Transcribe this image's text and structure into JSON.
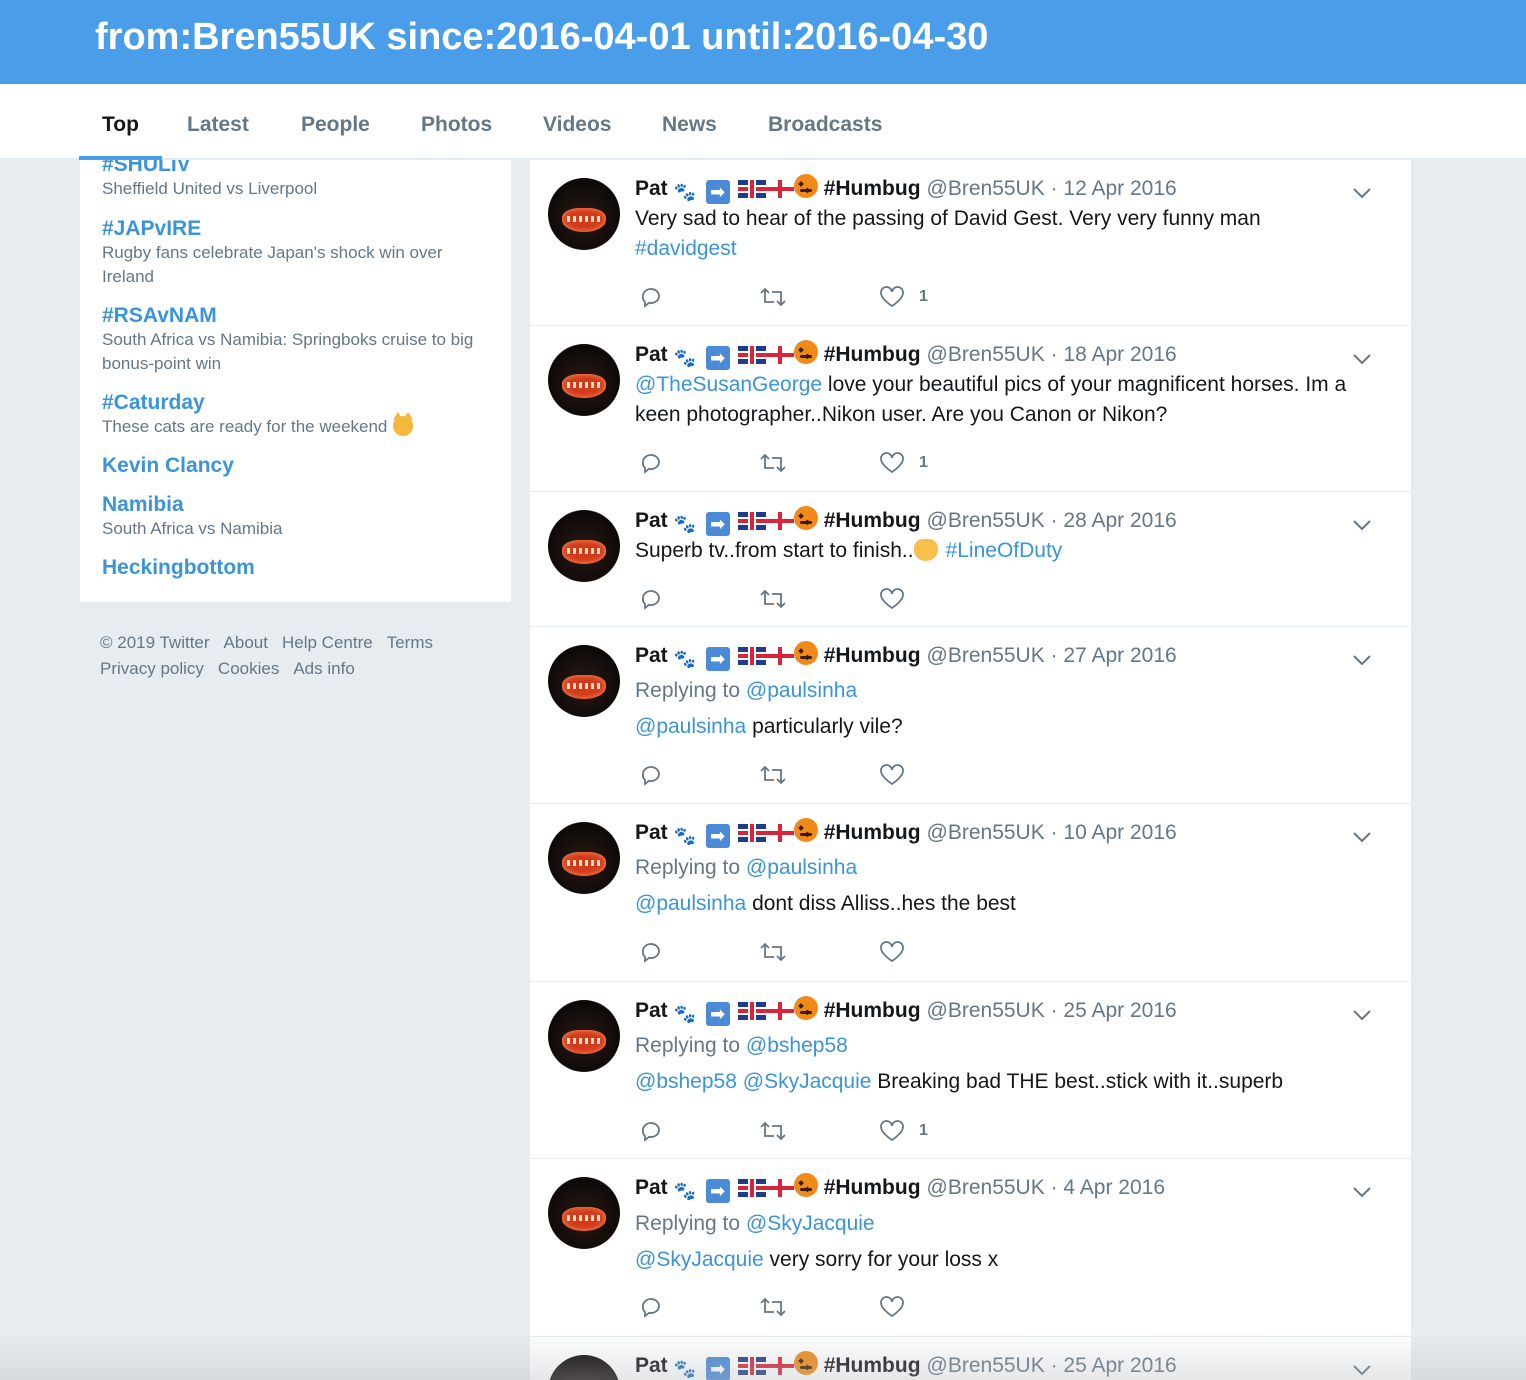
{
  "search": {
    "query": "from:Bren55UK since:2016-04-01 until:2016-04-30"
  },
  "nav": {
    "tabs": [
      {
        "label": "Top",
        "active": true
      },
      {
        "label": "Latest"
      },
      {
        "label": "People"
      },
      {
        "label": "Photos"
      },
      {
        "label": "Videos"
      },
      {
        "label": "News"
      },
      {
        "label": "Broadcasts"
      }
    ]
  },
  "trends": [
    {
      "name": "#SHULIV",
      "desc": "Sheffield United vs Liverpool"
    },
    {
      "name": "#JAPvIRE",
      "desc": "Rugby fans celebrate Japan's shock win over Ireland"
    },
    {
      "name": "#RSAvNAM",
      "desc": "South Africa vs Namibia: Springboks cruise to big bonus-point win"
    },
    {
      "name": "#Caturday",
      "desc": "These cats are ready for the weekend"
    },
    {
      "name": "Kevin Clancy",
      "desc": ""
    },
    {
      "name": "Namibia",
      "desc": "South Africa vs Namibia"
    },
    {
      "name": "Heckingbottom",
      "desc": ""
    }
  ],
  "footer": {
    "links": [
      "© 2019 Twitter",
      "About",
      "Help Centre",
      "Terms",
      "Privacy policy",
      "Cookies",
      "Ads info"
    ]
  },
  "user": {
    "name": "Pat",
    "name_suffix": "#Humbug",
    "handle": "@Bren55UK",
    "separator": "·",
    "arrow_glyph": "➡"
  },
  "tweets": [
    {
      "date": "12 Apr 2016",
      "text": "Very sad to hear of the passing of David Gest. Very very funny man",
      "hashtag": "#davidgest",
      "likes": "1"
    },
    {
      "date": "18 Apr 2016",
      "mention": "@TheSusanGeorge",
      "text": " love your beautiful pics of your magnificent horses. Im a keen photographer..Nikon user. Are you Canon or Nikon?",
      "likes": "1"
    },
    {
      "date": "28 Apr 2016",
      "text": "Superb tv..from start to finish..",
      "hashtag": "#LineOfDuty",
      "likes": ""
    },
    {
      "date": "27 Apr 2016",
      "reply_label": "Replying to ",
      "reply_to": "@paulsinha",
      "mention": "@paulsinha",
      "text": " particularly vile?",
      "likes": ""
    },
    {
      "date": "10 Apr 2016",
      "reply_label": "Replying to ",
      "reply_to": "@paulsinha",
      "mention": "@paulsinha",
      "text": " dont diss Alliss..hes the best",
      "likes": ""
    },
    {
      "date": "25 Apr 2016",
      "reply_label": "Replying to ",
      "reply_to": "@bshep58",
      "mention": "@bshep58",
      "mention2": "@SkyJacquie",
      "text": " Breaking bad THE best..stick with it..superb",
      "likes": "1"
    },
    {
      "date": "4 Apr 2016",
      "reply_label": "Replying to ",
      "reply_to": "@SkyJacquie",
      "mention": "@SkyJacquie",
      "text": " very sorry for your loss x",
      "likes": ""
    },
    {
      "date": "25 Apr 2016"
    }
  ],
  "colors": {
    "header_bg": "#4a9de8",
    "link": "#3b94d9",
    "muted": "#657786",
    "page_bg": "#e6ecf0"
  },
  "icons": {
    "reply": "reply-icon",
    "retweet": "retweet-icon",
    "like": "heart-icon",
    "more": "chevron-down-icon"
  }
}
